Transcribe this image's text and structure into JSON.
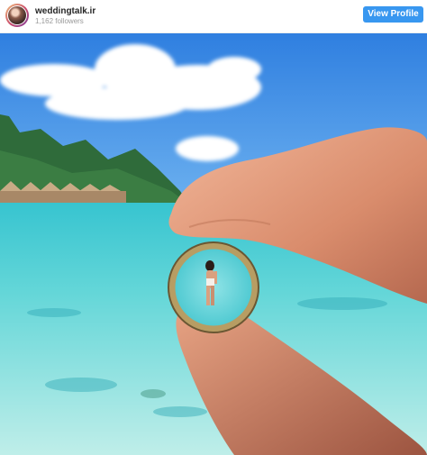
{
  "post": {
    "username": "weddingtalk.ir",
    "followers": "1,162 followers",
    "view_profile_label": "View Profile"
  },
  "icons": {
    "avatar": "profile-avatar",
    "photo": "beach-ring-photo"
  },
  "colors": {
    "accent": "#3897f0",
    "username": "#262626",
    "muted": "#999999"
  }
}
